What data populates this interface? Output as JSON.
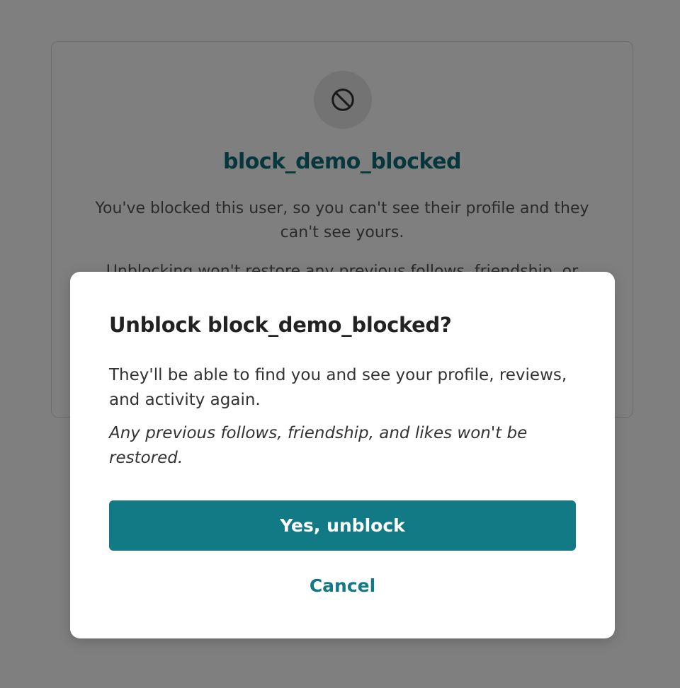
{
  "profile": {
    "icon": "block-icon",
    "username": "block_demo_blocked",
    "blocked_message": "You've blocked this user, so you can't see their profile and they can't see yours.",
    "unblock_note": "Unblocking won't restore any previous follows, friendship, or"
  },
  "dialog": {
    "title": "Unblock block_demo_blocked?",
    "body": "They'll be able to find you and see your profile, reviews, and activity again.",
    "note": "Any previous follows, friendship, and likes won't be restored.",
    "confirm_label": "Yes, unblock",
    "cancel_label": "Cancel"
  },
  "colors": {
    "accent": "#117a85",
    "username": "#0a6f78",
    "overlay": "rgba(0,0,0,0.5)"
  }
}
